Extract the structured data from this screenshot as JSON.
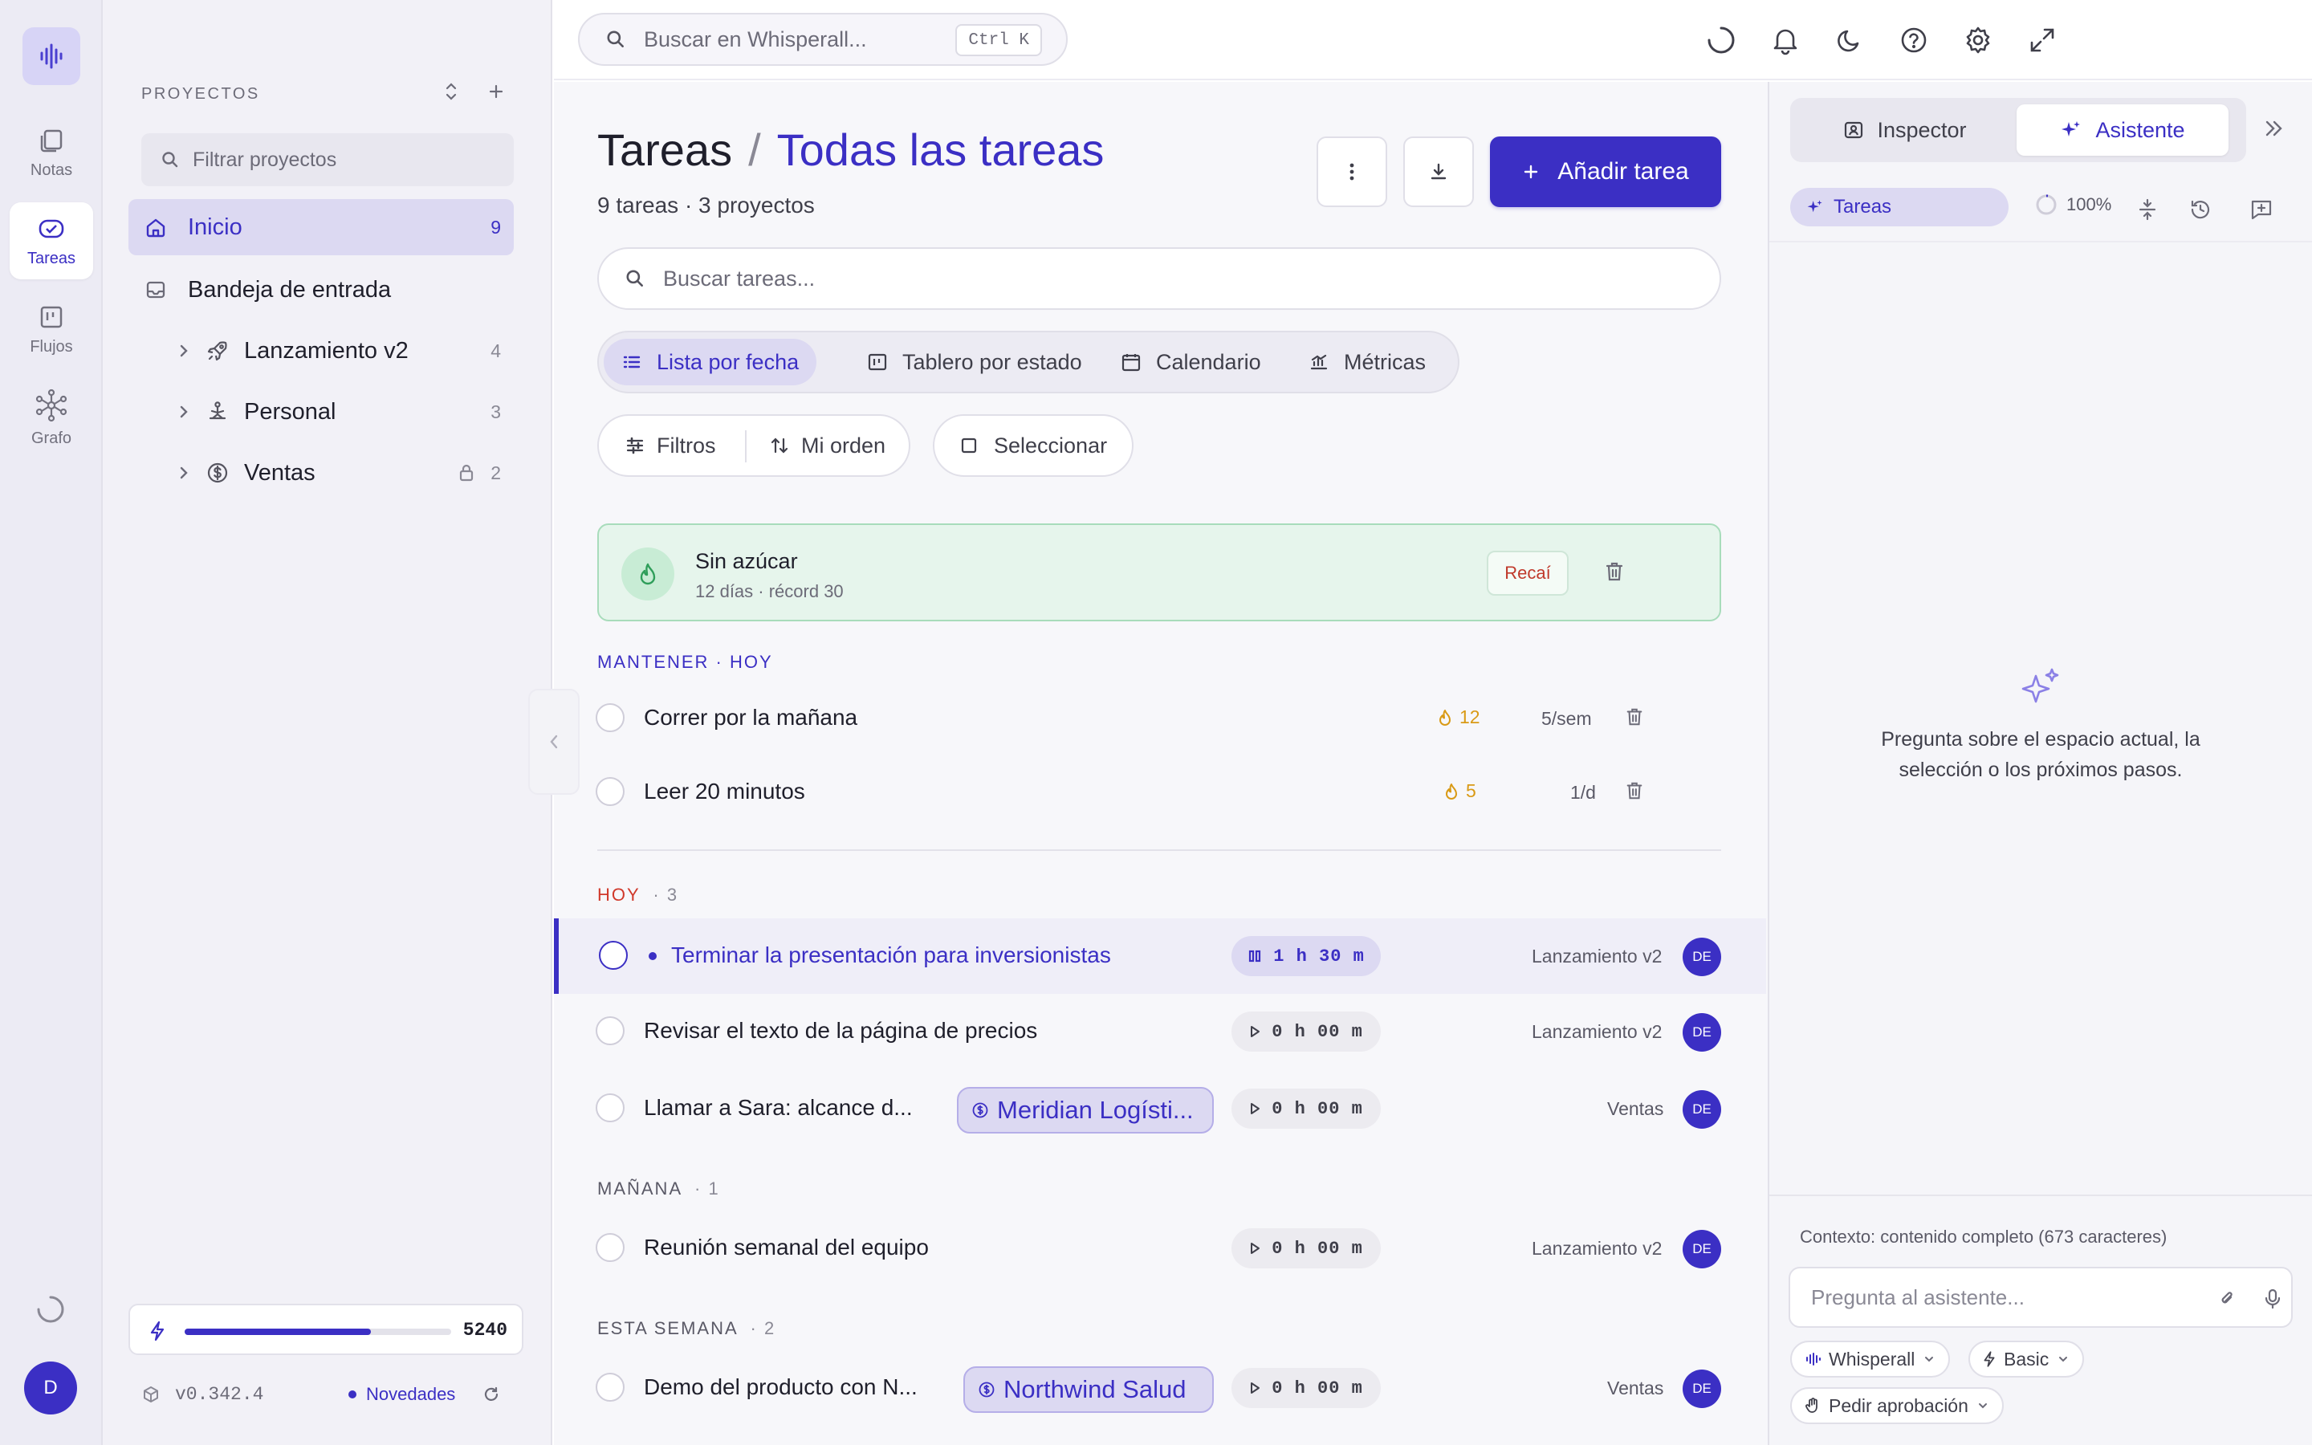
{
  "rail": {
    "items": [
      {
        "label": "Notas",
        "icon": "notes-icon"
      },
      {
        "label": "Tareas",
        "icon": "tasks-check-icon",
        "active": true
      },
      {
        "label": "Flujos",
        "icon": "flows-board-icon"
      },
      {
        "label": "Grafo",
        "icon": "graph-icon"
      }
    ],
    "avatar": "D"
  },
  "projects": {
    "header": "PROYECTOS",
    "filter_placeholder": "Filtrar proyectos",
    "inicio": {
      "label": "Inicio",
      "count": "9"
    },
    "inbox": {
      "label": "Bandeja de entrada"
    },
    "items": [
      {
        "label": "Lanzamiento v2",
        "count": "4",
        "icon": "rocket-icon"
      },
      {
        "label": "Personal",
        "count": "3",
        "icon": "meditation-icon"
      },
      {
        "label": "Ventas",
        "count": "2",
        "icon": "dollar-circle-icon",
        "locked": true
      }
    ],
    "xp_value": "5240",
    "xp_progress": 0.7,
    "version": "v0.342.4",
    "news": "Novedades"
  },
  "topbar": {
    "search_placeholder": "Buscar en Whisperall...",
    "shortcut": "Ctrl K"
  },
  "main": {
    "title": "Tareas",
    "separator": "/",
    "crumb": "Todas las tareas",
    "subtitle": "9 tareas · 3 proyectos",
    "add_label": "Añadir tarea",
    "search_placeholder": "Buscar tareas...",
    "views": [
      "Lista por fecha",
      "Tablero por estado",
      "Calendario",
      "Métricas"
    ],
    "filters_label": "Filtros",
    "order_label": "Mi orden",
    "select_label": "Seleccionar",
    "habit": {
      "name": "Sin azúcar",
      "meta": "12 días · récord 30",
      "relapse": "Recaí"
    },
    "maintain_label": "MANTENER · HOY",
    "habits": [
      {
        "title": "Correr por la mañana",
        "streak": "12",
        "freq": "5/sem"
      },
      {
        "title": "Leer 20 minutos",
        "streak": "5",
        "freq": "1/d"
      }
    ],
    "sections": {
      "today": {
        "label": "HOY",
        "count": "· 3"
      },
      "tomorrow": {
        "label": "MAÑANA",
        "count": "· 1"
      },
      "week": {
        "label": "ESTA SEMANA",
        "count": "· 2"
      }
    },
    "tasks": [
      {
        "title": "Terminar la presentación para inversionistas",
        "timer": "1 h 30 m",
        "project": "Lanzamiento v2",
        "assignee": "DE",
        "running": true
      },
      {
        "title": "Revisar el texto de la página de precios",
        "timer": "0 h 00 m",
        "project": "Lanzamiento v2",
        "assignee": "DE"
      },
      {
        "title": "Llamar a Sara: alcance d...",
        "tag": "Meridian Logísti...",
        "timer": "0 h 00 m",
        "project": "Ventas",
        "assignee": "DE"
      },
      {
        "title": "Reunión semanal del equipo",
        "timer": "0 h 00 m",
        "project": "Lanzamiento v2",
        "assignee": "DE"
      },
      {
        "title": "Demo del producto con N...",
        "tag": "Northwind Salud",
        "timer": "0 h 00 m",
        "project": "Ventas",
        "assignee": "DE"
      }
    ]
  },
  "assistant": {
    "tabs": [
      "Inspector",
      "Asistente"
    ],
    "active_tab": "Asistente",
    "chip": "Tareas",
    "zoom": "100%",
    "empty_text": "Pregunta sobre el espacio actual, la selección o los próximos pasos.",
    "context": "Contexto: contenido completo (673 caracteres)",
    "input_placeholder": "Pregunta al asistente...",
    "model_pill": "Whisperall",
    "mode_pill": "Basic",
    "approval_pill": "Pedir aprobación"
  },
  "colors": {
    "accent": "#3b2fc4",
    "danger": "#c0392b",
    "habit_bg": "#e6f5ec",
    "streak": "#d99a16"
  }
}
